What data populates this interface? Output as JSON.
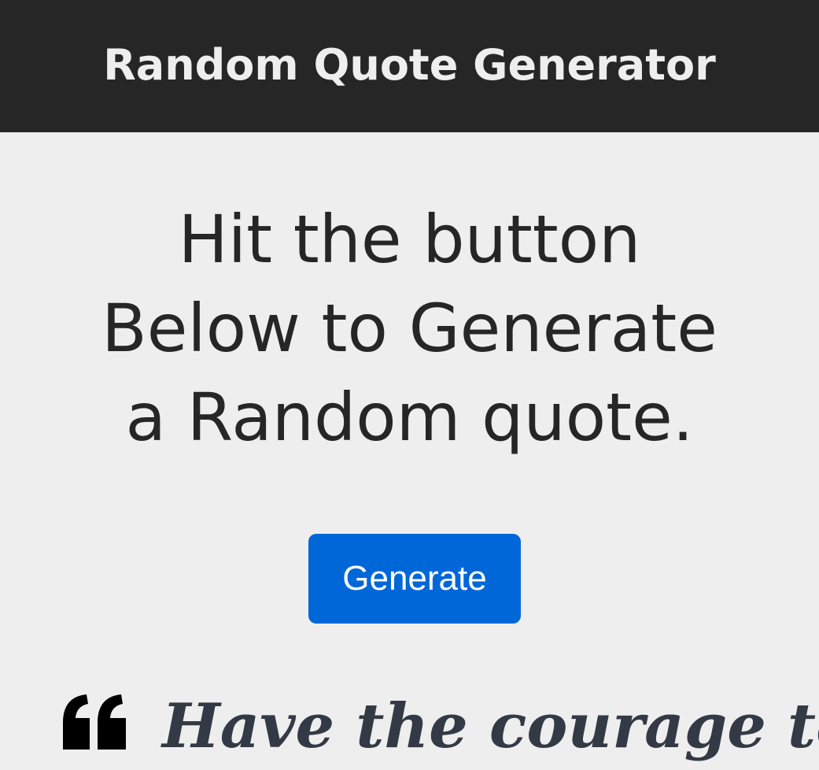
{
  "header": {
    "title": "Random Quote Generator"
  },
  "main": {
    "headline_lines": [
      "Hit the button",
      "Below to Generate",
      "a Random quote."
    ],
    "generate_button_label": "Generate",
    "quote_text": "Have the courage to"
  },
  "icons": {
    "quote": "quote-left-icon"
  },
  "colors": {
    "header_bg": "#262626",
    "page_bg": "#eeeeee",
    "button_bg": "#0067d8",
    "quote_text": "#343a45"
  }
}
